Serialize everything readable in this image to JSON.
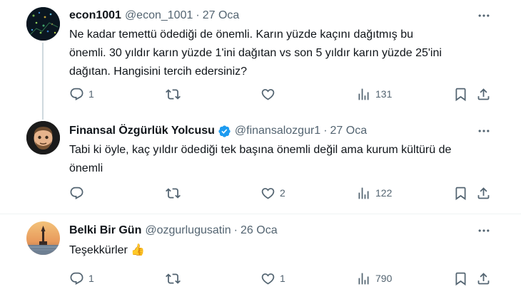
{
  "tweets": [
    {
      "name": "econ1001",
      "handle": "@econ_1001",
      "separator": "·",
      "time": "27 Oca",
      "verified": false,
      "text_lines": [
        "Ne kadar temettü ödediği de önemli. Karın yüzde kaçını dağıtmış bu",
        "önemli. 30 yıldır karın yüzde 1'ini dağıtan vs son 5 yıldır karın yüzde 25'ini",
        "dağıtan. Hangisini tercih edersiniz?"
      ],
      "replies": "1",
      "retweets": "",
      "likes": "",
      "views": "131"
    },
    {
      "name": "Finansal Özgürlük Yolcusu",
      "handle": "@finansalozgur1",
      "separator": "·",
      "time": "27 Oca",
      "verified": true,
      "text_lines": [
        "Tabi ki öyle, kaç yıldır ödediği tek başına önemli değil ama kurum kültürü de",
        "önemli"
      ],
      "replies": "",
      "retweets": "",
      "likes": "2",
      "views": "122"
    },
    {
      "name": "Belki Bir Gün",
      "handle": "@ozgurlugusatin",
      "separator": "·",
      "time": "26 Oca",
      "verified": false,
      "text_lines": [
        "Teşekkürler 👍"
      ],
      "replies": "1",
      "retweets": "",
      "likes": "1",
      "views": "790"
    }
  ],
  "icons": {
    "reply": "reply-icon",
    "retweet": "retweet-icon",
    "like": "like-icon",
    "views": "views-icon",
    "bookmark": "bookmark-icon",
    "share": "share-icon",
    "more": "more-icon",
    "verified": "verified-badge-icon"
  },
  "colors": {
    "text": "#0f1419",
    "secondary": "#536471",
    "verified": "#1d9bf0",
    "divider": "#eff3f4"
  }
}
